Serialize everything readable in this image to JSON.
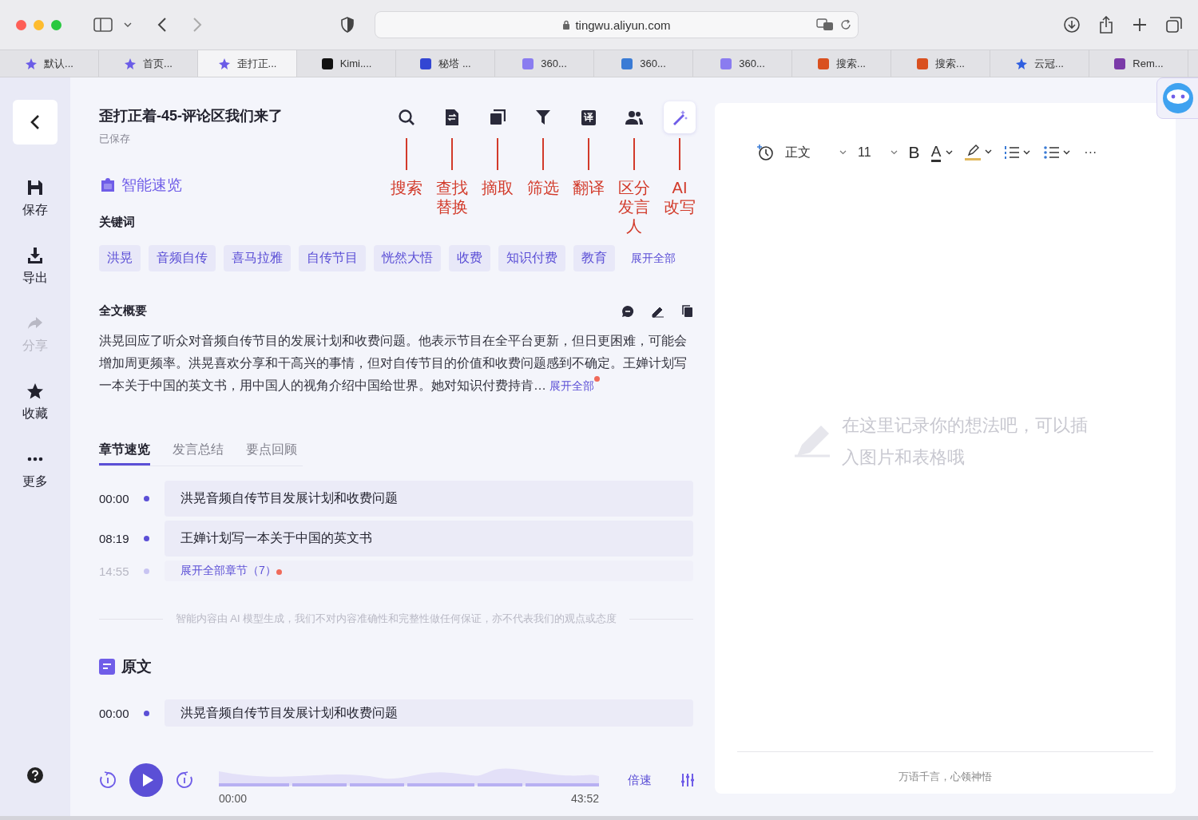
{
  "browser": {
    "url": "tingwu.aliyun.com",
    "tabs": [
      {
        "title": "默认...",
        "kind": "spiral",
        "selected": false
      },
      {
        "title": "首页...",
        "kind": "spiral",
        "selected": false
      },
      {
        "title": "歪打正...",
        "kind": "spiral",
        "selected": true
      },
      {
        "title": "Kimi....",
        "kind": "kimi",
        "selected": false
      },
      {
        "title": "秘塔 ...",
        "kind": "metaso",
        "selected": false
      },
      {
        "title": "360...",
        "kind": "cube",
        "selected": false
      },
      {
        "title": "360...",
        "kind": "bubble",
        "selected": false
      },
      {
        "title": "360...",
        "kind": "cube",
        "selected": false
      },
      {
        "title": "搜索...",
        "kind": "bear",
        "selected": false
      },
      {
        "title": "搜索...",
        "kind": "bear",
        "selected": false
      },
      {
        "title": "云冠...",
        "kind": "paw",
        "selected": false
      },
      {
        "title": "Rem...",
        "kind": "grid",
        "selected": false
      }
    ]
  },
  "sidebar": {
    "items": [
      {
        "label": "保存",
        "kind": "save",
        "disabled": false
      },
      {
        "label": "导出",
        "kind": "export",
        "disabled": false
      },
      {
        "label": "分享",
        "kind": "share",
        "disabled": true
      },
      {
        "label": "收藏",
        "kind": "star",
        "disabled": false
      },
      {
        "label": "更多",
        "kind": "more",
        "disabled": false
      }
    ]
  },
  "document": {
    "title": "歪打正着-45-评论区我们来了",
    "status": "已保存"
  },
  "tools": [
    {
      "kind": "search",
      "label": "搜索",
      "selected": false
    },
    {
      "kind": "replace",
      "label": "查找替换",
      "selected": false
    },
    {
      "kind": "extract",
      "label": "摘取",
      "selected": false
    },
    {
      "kind": "filter",
      "label": "筛选",
      "selected": false
    },
    {
      "kind": "translate",
      "label": "翻译",
      "icon_text": "译",
      "selected": false
    },
    {
      "kind": "speakers",
      "label": "区分发言人",
      "selected": false
    },
    {
      "kind": "rewrite",
      "label": "AI改写",
      "selected": true
    }
  ],
  "overview": {
    "heading": "智能速览",
    "keywords_label": "关键词",
    "keywords": [
      "洪晃",
      "音频自传",
      "喜马拉雅",
      "自传节目",
      "恍然大悟",
      "收费",
      "知识付费",
      "教育"
    ],
    "keywords_more": "展开全部",
    "summary_label": "全文概要",
    "summary": "洪晃回应了听众对音频自传节目的发展计划和收费问题。他表示节目在全平台更新，但日更困难，可能会增加周更频率。洪晃喜欢分享和干高兴的事情，但对自传节目的价值和收费问题感到不确定。王婵计划写一本关于中国的英文书，用中国人的视角介绍中国给世界。她对知识付费持肯…",
    "summary_more": "展开全部"
  },
  "chapter_tabs": [
    {
      "label": "章节速览",
      "selected": true
    },
    {
      "label": "发言总结",
      "selected": false
    },
    {
      "label": "要点回顾",
      "selected": false
    }
  ],
  "chapters": [
    {
      "time": "00:00",
      "title": "洪晃音频自传节目发展计划和收费问题"
    },
    {
      "time": "08:19",
      "title": "王婵计划写一本关于中国的英文书"
    }
  ],
  "chapters_more": {
    "time": "14:55",
    "label": "展开全部章节（7）"
  },
  "disclaimer": "智能内容由 AI 模型生成，我们不对内容准确性和完整性做任何保证，亦不代表我们的观点或态度",
  "transcript": {
    "heading": "原文",
    "rows": [
      {
        "time": "00:00",
        "text": "洪晃音频自传节目发展计划和收费问题"
      }
    ]
  },
  "player": {
    "current": "00:00",
    "total": "43:52",
    "speed": "倍速"
  },
  "editor": {
    "style": "正文",
    "size": "11",
    "bold": "B",
    "font_color": "A",
    "more": "···",
    "placeholder": "在这里记录你的想法吧，可以插入图片和表格哦",
    "footer": "万语千言，心领神悟"
  }
}
